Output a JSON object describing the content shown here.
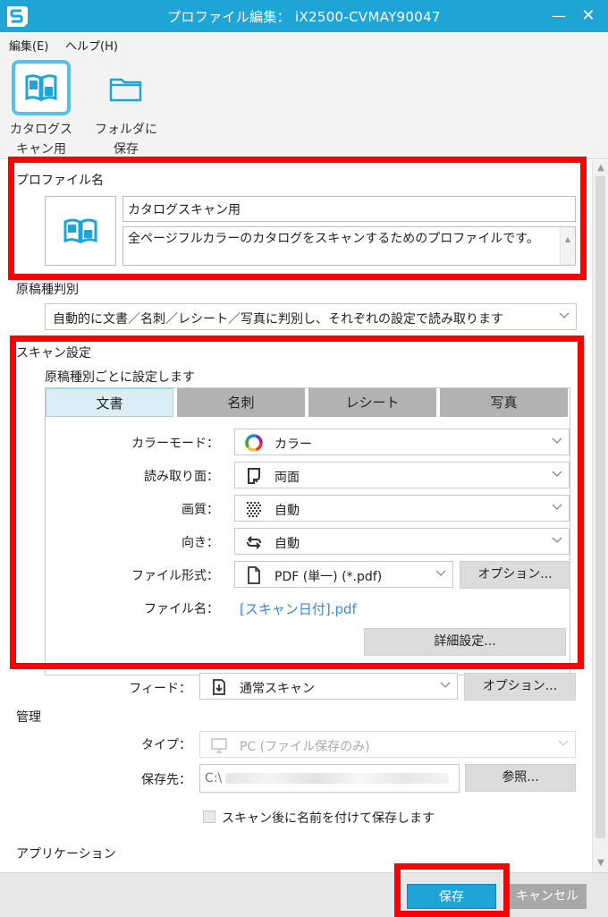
{
  "window": {
    "title": "プロファイル編集： iX2500-CVMAY90047",
    "minimize_symbol": "—",
    "close_symbol": "✕",
    "brand_color": "#1ea5d6"
  },
  "menu": {
    "items": [
      {
        "label": "編集(E)"
      },
      {
        "label": "ヘルプ(H)"
      }
    ]
  },
  "toolbar": {
    "items": [
      {
        "label_line1": "カタログス",
        "label_line2": "キャン用",
        "icon": "open-book-icon",
        "active": true
      },
      {
        "label_line1": "フォルダに",
        "label_line2": "保存",
        "icon": "folder-icon",
        "active": false
      }
    ]
  },
  "profile": {
    "section_label": "プロファイル名",
    "icon": "open-book-icon",
    "name": "カタログスキャン用",
    "description": "全ページフルカラーのカタログをスキャンするためのプロファイルです。",
    "desc_scroll_up": "▲",
    "desc_scroll_down": "▼"
  },
  "doc_type": {
    "section_label": "原稿種判別",
    "value": "自動的に文書／名刺／レシート／写真に判別し、それぞれの設定で読み取ります"
  },
  "scan_settings": {
    "section_label": "スキャン設定",
    "per_type_label": "原稿種別ごとに設定します",
    "tabs": [
      {
        "label": "文書",
        "active": true
      },
      {
        "label": "名刺",
        "active": false
      },
      {
        "label": "レシート",
        "active": false
      },
      {
        "label": "写真",
        "active": false
      }
    ],
    "color_mode": {
      "label": "カラーモード：",
      "value": "カラー",
      "icon": "color-wheel-icon"
    },
    "scan_side": {
      "label": "読み取り面：",
      "value": "両面",
      "icon": "duplex-page-icon"
    },
    "quality": {
      "label": "画質：",
      "value": "自動",
      "icon": "dot-pattern-icon"
    },
    "orientation": {
      "label": "向き：",
      "value": "自動",
      "icon": "rotate-arrows-icon"
    },
    "file_format": {
      "label": "ファイル形式：",
      "value": "PDF (単一) (*.pdf)",
      "icon": "file-icon",
      "option_button": "オプション..."
    },
    "file_name": {
      "label": "ファイル名：",
      "value": "[スキャン日付].pdf"
    },
    "detail_button": "詳細設定..."
  },
  "feed": {
    "label": "フィード：",
    "value": "通常スキャン",
    "icon": "paper-feed-icon",
    "option_button": "オプション..."
  },
  "management": {
    "section_label": "管理",
    "type": {
      "label": "タイプ：",
      "value": "PC (ファイル保存のみ)",
      "icon": "computer-icon"
    },
    "save_to": {
      "label": "保存先：",
      "value": "C:\\",
      "browse_button": "参照..."
    },
    "rename_checkbox": {
      "label": "スキャン後に名前を付けて保存します",
      "checked": false
    }
  },
  "application": {
    "section_label": "アプリケーション"
  },
  "scrollbar": {
    "up": "▲",
    "down": "▼"
  },
  "footer": {
    "save_button": "保存",
    "cancel_button": "キャンセル"
  },
  "highlight_color": "#ff0000"
}
